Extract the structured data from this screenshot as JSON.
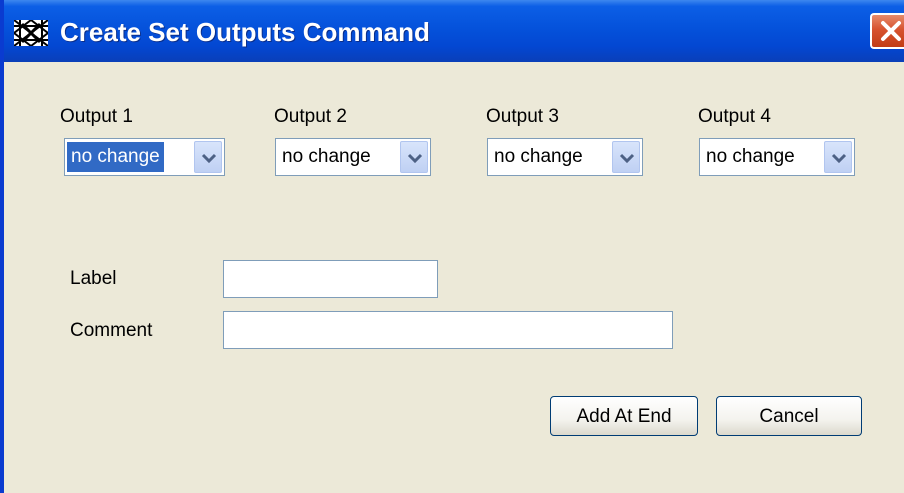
{
  "window": {
    "title": "Create Set Outputs Command",
    "icon": "app-pattern-icon",
    "close_icon": "close-icon"
  },
  "outputs": [
    {
      "label": "Output 1",
      "value": "no change",
      "selected": true
    },
    {
      "label": "Output 2",
      "value": "no change",
      "selected": false
    },
    {
      "label": "Output 3",
      "value": "no change",
      "selected": false
    },
    {
      "label": "Output 4",
      "value": "no change",
      "selected": false
    }
  ],
  "form": {
    "label_caption": "Label",
    "label_value": "",
    "comment_caption": "Comment",
    "comment_value": ""
  },
  "buttons": {
    "add_at_end": "Add At End",
    "cancel": "Cancel"
  },
  "colors": {
    "titlebar": "#0552db",
    "dialog_bg": "#ece9d8",
    "selection": "#316ac5",
    "close": "#d7532f"
  }
}
